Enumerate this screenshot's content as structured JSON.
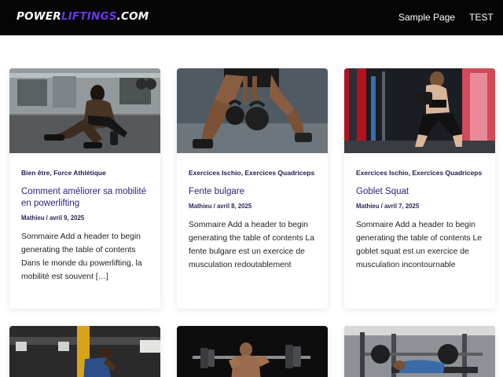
{
  "header": {
    "logo_part1": "POWER",
    "logo_part2": "LIFTINGS",
    "logo_part3": ".COM",
    "nav": [
      "Sample Page",
      "TEST"
    ]
  },
  "colors": {
    "topbar": "#050505",
    "logo_accent": "#6c35e8",
    "title": "#2b1f7a"
  },
  "posts": [
    {
      "categories": "Bien être, Force Athlétique",
      "title": "Comment améliorer sa mobilité en powerlifting",
      "meta": "Mathieu / avril 9, 2025",
      "excerpt": "Sommaire Add a header to begin generating the table of contents Dans le monde du powerlifting, la mobilité est souvent […]"
    },
    {
      "categories": "Exercices Ischio, Exercices Quadriceps",
      "title": "Fente bulgare",
      "meta": "Mathieu / avril 8, 2025",
      "excerpt": "Sommaire Add a header to begin generating the table of contents La fente bulgare est un exercice de musculation redoutablement"
    },
    {
      "categories": "Exercices Ischio, Exercices Quadriceps",
      "title": "Goblet Squat",
      "meta": "Mathieu / avril 7, 2025",
      "excerpt": "Sommaire Add a header to begin generating the table of contents Le goblet squat est un exercice de musculation incontournable"
    }
  ]
}
